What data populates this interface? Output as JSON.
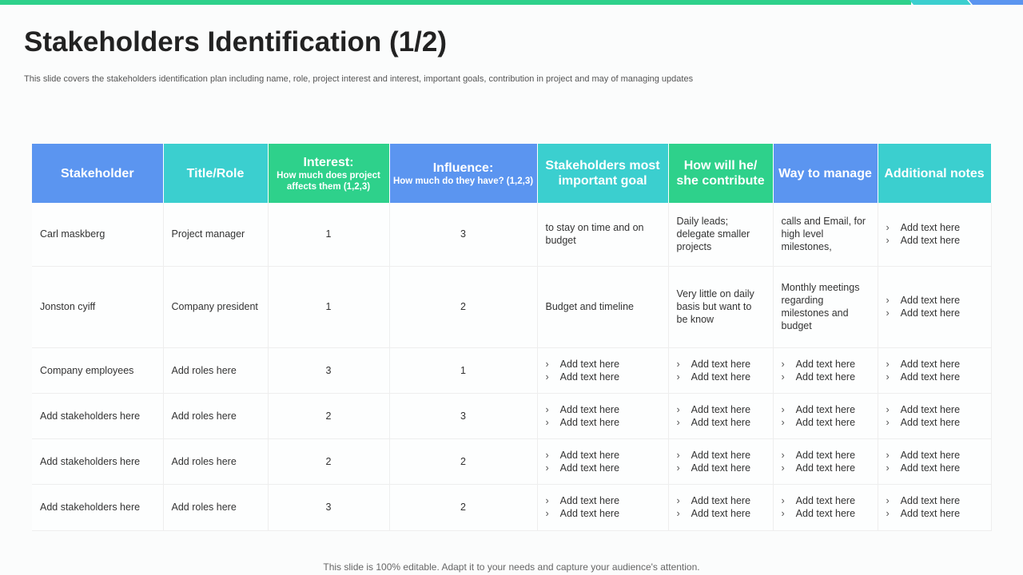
{
  "title": "Stakeholders Identification (1/2)",
  "subtitle": "This slide covers the stakeholders identification plan including name, role, project interest and interest, important goals, contribution in project and may of managing updates",
  "colors": {
    "blue": "#5b95f0",
    "teal": "#3bcfcf",
    "green": "#2ed18b"
  },
  "headers": [
    {
      "label": "Stakeholder"
    },
    {
      "label": "Title/Role"
    },
    {
      "label": "Interest:",
      "sub": "How much does project affects them (1,2,3)"
    },
    {
      "label": "Influence:",
      "sub": "How much do they have? (1,2,3)"
    },
    {
      "label": "Stakeholders most important goal"
    },
    {
      "label": "How will he/ she contribute"
    },
    {
      "label": "Way to manage"
    },
    {
      "label": "Additional notes"
    }
  ],
  "rows": [
    {
      "stakeholder": "Carl maskberg",
      "role": "Project manager",
      "interest": "1",
      "influence": "3",
      "goal": [
        "to stay on time and on budget"
      ],
      "contribute": [
        "Daily leads; delegate smaller projects"
      ],
      "manage": [
        "calls and Email, for high level milestones,"
      ],
      "notes": [
        "Add text here",
        "Add text here"
      ]
    },
    {
      "stakeholder": "Jonston cyiff",
      "role": "Company president",
      "interest": "1",
      "influence": "2",
      "goal": [
        "Budget and timeline"
      ],
      "contribute": [
        "Very little on daily basis but want to be know"
      ],
      "manage": [
        "Monthly meetings regarding milestones and budget"
      ],
      "notes": [
        "Add text here",
        "Add text here"
      ]
    },
    {
      "stakeholder": "Company employees",
      "role": "Add roles here",
      "interest": "3",
      "influence": "1",
      "goal": [
        "Add text here",
        "Add text here"
      ],
      "contribute": [
        "Add text here",
        "Add text here"
      ],
      "manage": [
        "Add text here",
        "Add text here"
      ],
      "notes": [
        "Add text here",
        "Add text here"
      ]
    },
    {
      "stakeholder": "Add stakeholders here",
      "role": "Add roles here",
      "interest": "2",
      "influence": "3",
      "goal": [
        "Add text here",
        "Add text here"
      ],
      "contribute": [
        "Add text here",
        "Add text here"
      ],
      "manage": [
        "Add text here",
        "Add text here"
      ],
      "notes": [
        "Add text here",
        "Add text here"
      ]
    },
    {
      "stakeholder": "Add stakeholders here",
      "role": "Add roles here",
      "interest": "2",
      "influence": "2",
      "goal": [
        "Add text here",
        "Add text here"
      ],
      "contribute": [
        "Add text here",
        "Add text here"
      ],
      "manage": [
        "Add text here",
        "Add text here"
      ],
      "notes": [
        "Add text here",
        "Add text here"
      ]
    },
    {
      "stakeholder": "Add stakeholders here",
      "role": "Add roles here",
      "interest": "3",
      "influence": "2",
      "goal": [
        "Add text here",
        "Add text here"
      ],
      "contribute": [
        "Add text here",
        "Add text here"
      ],
      "manage": [
        "Add text here",
        "Add text here"
      ],
      "notes": [
        "Add text here",
        "Add text here"
      ]
    }
  ],
  "footer": "This slide is 100% editable. Adapt it to your needs and capture your audience's attention."
}
